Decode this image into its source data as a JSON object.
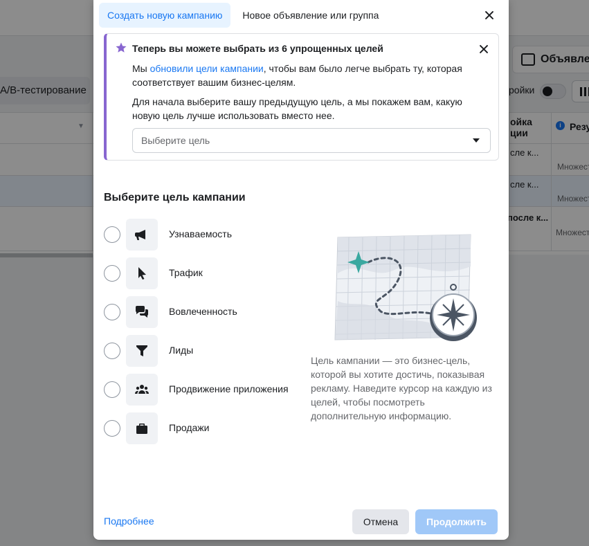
{
  "background": {
    "ab_test_button": "A/B-тестирование",
    "right_tab_label": "Объявле",
    "settings_label": "ройки",
    "column_header_1": "ойка\nции",
    "column_header_2": "Резу",
    "rows": [
      {
        "col1": "сле к...",
        "col2": "Множест"
      },
      {
        "col1": "сле к...",
        "col2": "Множест"
      },
      {
        "col1": "после к...",
        "col2": "Множест"
      }
    ]
  },
  "modal": {
    "tabs": [
      {
        "label": "Создать новую кампанию",
        "active": true
      },
      {
        "label": "Новое объявление или группа",
        "active": false
      }
    ],
    "notice": {
      "title": "Теперь вы можете выбрать из 6 упрощенных целей",
      "p1_before": "Мы ",
      "p1_link": "обновили цели кампании",
      "p1_after": ", чтобы вам было легче выбрать ту, которая соответствует вашим бизнес-целям.",
      "p2": "Для начала выберите вашу предыдущую цель, а мы покажем вам, какую новую цель лучше использовать вместо нее.",
      "select_placeholder": "Выберите цель"
    },
    "section_title": "Выберите цель кампании",
    "objectives": [
      {
        "label": "Узнаваемость",
        "icon": "megaphone-icon"
      },
      {
        "label": "Трафик",
        "icon": "cursor-icon"
      },
      {
        "label": "Вовлеченность",
        "icon": "chat-bubbles-icon"
      },
      {
        "label": "Лиды",
        "icon": "funnel-icon"
      },
      {
        "label": "Продвижение приложения",
        "icon": "people-icon"
      },
      {
        "label": "Продажи",
        "icon": "briefcase-icon"
      }
    ],
    "description": "Цель кампании — это бизнес-цель, которой вы хотите достичь, показывая рекламу. Наведите курсор на каждую из целей, чтобы посмотреть дополнительную информацию.",
    "footer": {
      "learn_more": "Подробнее",
      "cancel": "Отмена",
      "continue": "Продолжить"
    }
  },
  "colors": {
    "accent": "#1877f2",
    "notice_border": "#8866d0",
    "continue_disabled": "#a0c8f8"
  }
}
